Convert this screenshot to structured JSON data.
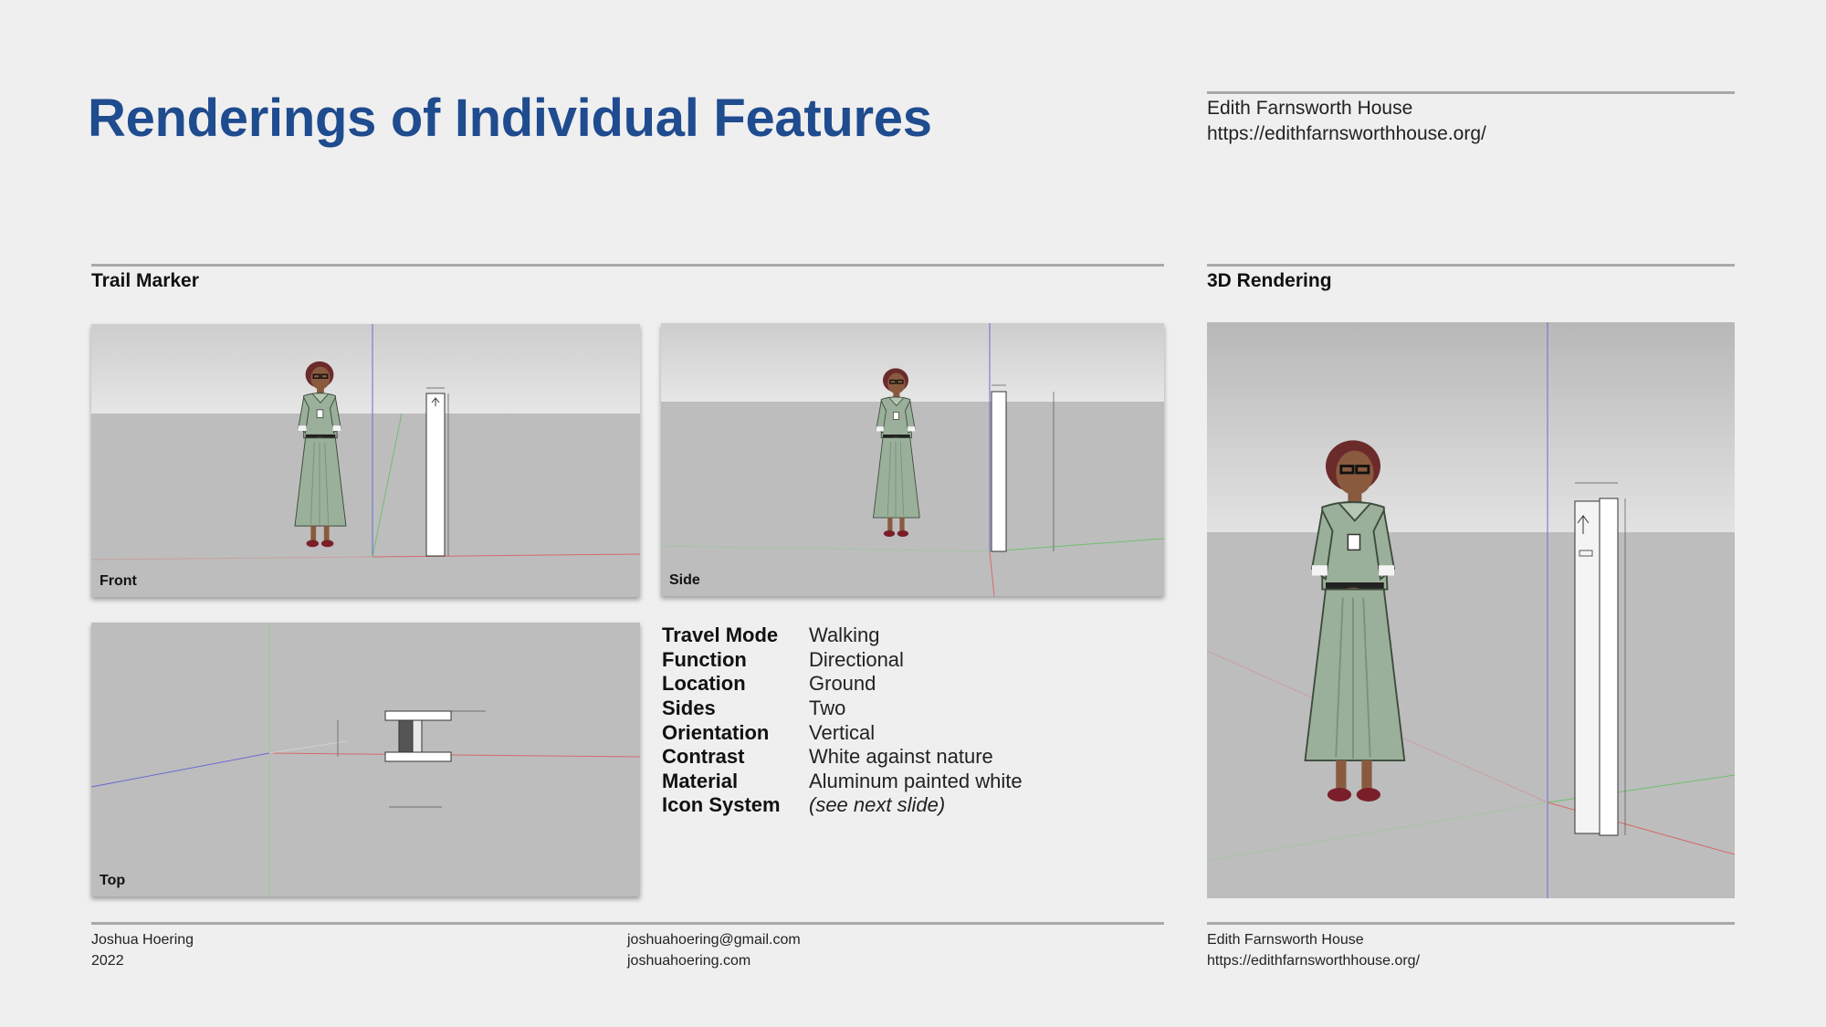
{
  "header": {
    "title": "Renderings of Individual Features",
    "org_name": "Edith Farnsworth House",
    "org_url": "https://edithfarnsworthhouse.org/"
  },
  "sections": {
    "left_label": "Trail Marker",
    "right_label": "3D Rendering"
  },
  "panels": {
    "front": "Front",
    "side": "Side",
    "top": "Top"
  },
  "specs": [
    {
      "key": "Travel Mode",
      "value": "Walking"
    },
    {
      "key": "Function",
      "value": "Directional"
    },
    {
      "key": "Location",
      "value": "Ground"
    },
    {
      "key": "Sides",
      "value": "Two"
    },
    {
      "key": "Orientation",
      "value": "Vertical"
    },
    {
      "key": "Contrast",
      "value": "White against nature"
    },
    {
      "key": "Material",
      "value": "Aluminum painted white"
    },
    {
      "key": "Icon System",
      "value": "(see next slide)"
    }
  ],
  "footer": {
    "author": "Joshua Hoering",
    "year": "2022",
    "email": "joshuahoering@gmail.com",
    "website": "joshuahoering.com",
    "org_name": "Edith Farnsworth House",
    "org_url": "https://edithfarnsworthhouse.org/"
  },
  "colors": {
    "title": "#1f4b8f",
    "background": "#efefef",
    "rule": "#a9a9a9",
    "dress": "#9bb09a",
    "axis_red": "#d46a6a",
    "axis_green": "#6fbf6f",
    "axis_blue": "#6a6ad4"
  },
  "icons": [
    "woman-figure",
    "trail-marker-post",
    "up-arrow-icon"
  ]
}
